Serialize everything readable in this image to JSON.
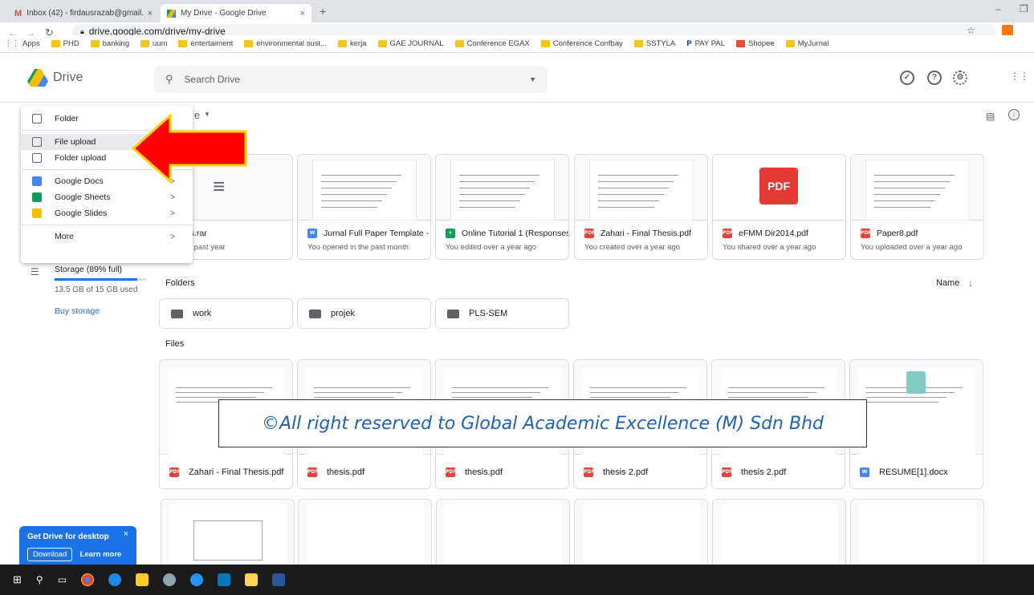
{
  "browser": {
    "tabs": [
      {
        "title": "Inbox (42) - firdausrazab@gmail...",
        "close": "×"
      },
      {
        "title": "My Drive - Google Drive",
        "close": "×"
      }
    ],
    "new_tab": "+",
    "url": "drive.google.com/drive/my-drive",
    "bookmarks": [
      "Apps",
      "PHD",
      "banking",
      "uum",
      "entertaiment",
      "environmental sust...",
      "kerja",
      "GAE JOURNAL",
      "Conference EGAX",
      "Conference Confbay",
      "SSTYLA",
      "PAY PAL",
      "Shopee",
      "MyJurnal"
    ]
  },
  "drive": {
    "logo_text": "Drive",
    "search_placeholder": "Search Drive",
    "breadcrumb_fragment": "e",
    "storage_label": "Storage (89% full)",
    "storage_used": "13.5 GB of 15 GB used",
    "storage_fraction": 0.9,
    "buy_storage": "Buy storage",
    "folders_heading": "Folders",
    "files_heading": "Files",
    "sort_label": "Name"
  },
  "menu": {
    "items": [
      {
        "label": "Folder",
        "icon": "new-folder-icon"
      },
      {
        "label": "File upload",
        "icon": "file-upload-icon"
      },
      {
        "label": "Folder upload",
        "icon": "folder-upload-icon"
      },
      {
        "label": "Google Docs",
        "icon": "docs-icon",
        "arrow": ">"
      },
      {
        "label": "Google Sheets",
        "icon": "sheets-icon",
        "arrow": ">"
      },
      {
        "label": "Google Slides",
        "icon": "slides-icon",
        "arrow": ">"
      },
      {
        "label": "More",
        "icon": "",
        "arrow": ">"
      }
    ]
  },
  "suggested": [
    {
      "name": "nloads.rar",
      "sub": "l in the past year",
      "type": "rar"
    },
    {
      "name": "Jurnal Full Paper Template - ...",
      "sub": "You opened in the past month",
      "type": "word"
    },
    {
      "name": "Online Tutorial 1 (Responses)",
      "sub": "You edited over a year ago",
      "type": "sheet"
    },
    {
      "name": "Zahari - Final Thesis.pdf",
      "sub": "You created over a year ago",
      "type": "pdf"
    },
    {
      "name": "eFMM Dir2014.pdf",
      "sub": "You shared over a year ago",
      "type": "pdf"
    },
    {
      "name": "Paper8.pdf",
      "sub": "You uploaded over a year ago",
      "type": "pdf"
    }
  ],
  "folders": [
    {
      "name": "work"
    },
    {
      "name": "projek"
    },
    {
      "name": "PLS-SEM"
    }
  ],
  "files": [
    {
      "name": "Zahari - Final Thesis.pdf",
      "type": "pdf"
    },
    {
      "name": "thesis.pdf",
      "type": "pdf"
    },
    {
      "name": "thesis.pdf",
      "type": "pdf"
    },
    {
      "name": "thesis 2.pdf",
      "type": "pdf"
    },
    {
      "name": "thesis 2.pdf",
      "type": "pdf"
    },
    {
      "name": "RESUME[1].docx",
      "type": "word"
    }
  ],
  "promo": {
    "title": "Get Drive for desktop",
    "download": "Download",
    "learn_more": "Learn more"
  },
  "watermark": "©All right reserved to Global Academic Excellence (M) Sdn Bhd",
  "colors": {
    "accent": "#1a73e8",
    "arrow": "#ff0000",
    "arrow_outline": "#ffd400"
  }
}
